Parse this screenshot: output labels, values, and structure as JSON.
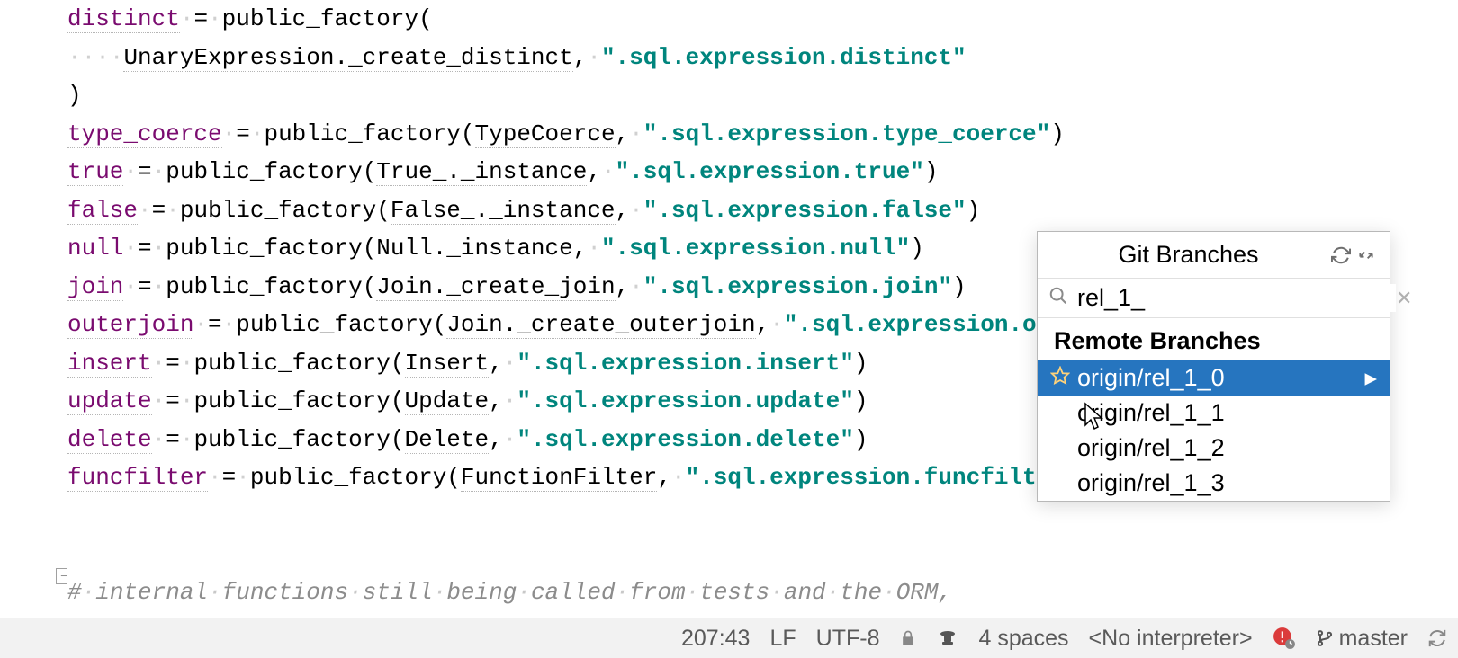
{
  "code": {
    "lines": [
      {
        "type": "assign",
        "var": "distinct",
        "pre": "",
        "call": "public_factory(",
        "args": ""
      },
      {
        "type": "cont",
        "text": "    UnaryExpression._create_distinct, ",
        "str": "\".sql.expression.distinct\""
      },
      {
        "type": "close",
        "text": ")"
      },
      {
        "type": "assign",
        "var": "type_coerce",
        "call": "public_factory(TypeCoerce, ",
        "str": "\".sql.expression.type_coerce\"",
        "close": ")"
      },
      {
        "type": "assign",
        "var": "true",
        "call": "public_factory(True_._instance, ",
        "str": "\".sql.expression.true\"",
        "close": ")"
      },
      {
        "type": "assign",
        "var": "false",
        "call": "public_factory(False_._instance, ",
        "str": "\".sql.expression.false\"",
        "close": ")"
      },
      {
        "type": "assign",
        "var": "null",
        "call": "public_factory(Null._instance, ",
        "str": "\".sql.expression.null\"",
        "close": ")"
      },
      {
        "type": "assign",
        "var": "join",
        "call": "public_factory(Join._create_join, ",
        "str": "\".sql.expression.join\"",
        "close": ")"
      },
      {
        "type": "assign",
        "var": "outerjoin",
        "call": "public_factory(Join._create_outerjoin, ",
        "str": "\".sql.expression.o",
        "close": ""
      },
      {
        "type": "assign",
        "var": "insert",
        "call": "public_factory(Insert, ",
        "str": "\".sql.expression.insert\"",
        "close": ")"
      },
      {
        "type": "assign",
        "var": "update",
        "call": "public_factory(Update, ",
        "str": "\".sql.expression.update\"",
        "close": ")"
      },
      {
        "type": "assign",
        "var": "delete",
        "call": "public_factory(Delete, ",
        "str": "\".sql.expression.delete\"",
        "close": ")"
      },
      {
        "type": "assign",
        "var": "funcfilter",
        "call": "public_factory(FunctionFilter, ",
        "str": "\".sql.expression.funcfilt",
        "close": ""
      },
      {
        "type": "blank"
      },
      {
        "type": "blank"
      },
      {
        "type": "comment",
        "text": "# internal functions still being called from tests and the ORM,"
      }
    ]
  },
  "popup": {
    "title": "Git Branches",
    "search_value": "rel_1_",
    "section": "Remote Branches",
    "branches": [
      {
        "name": "origin/rel_1_0",
        "selected": true,
        "starred": true
      },
      {
        "name": "origin/rel_1_1",
        "selected": false,
        "starred": false
      },
      {
        "name": "origin/rel_1_2",
        "selected": false,
        "starred": false
      },
      {
        "name": "origin/rel_1_3",
        "selected": false,
        "starred": false
      }
    ]
  },
  "status": {
    "position": "207:43",
    "line_sep": "LF",
    "encoding": "UTF-8",
    "indent": "4 spaces",
    "interpreter": "<No interpreter>",
    "branch": "master"
  }
}
